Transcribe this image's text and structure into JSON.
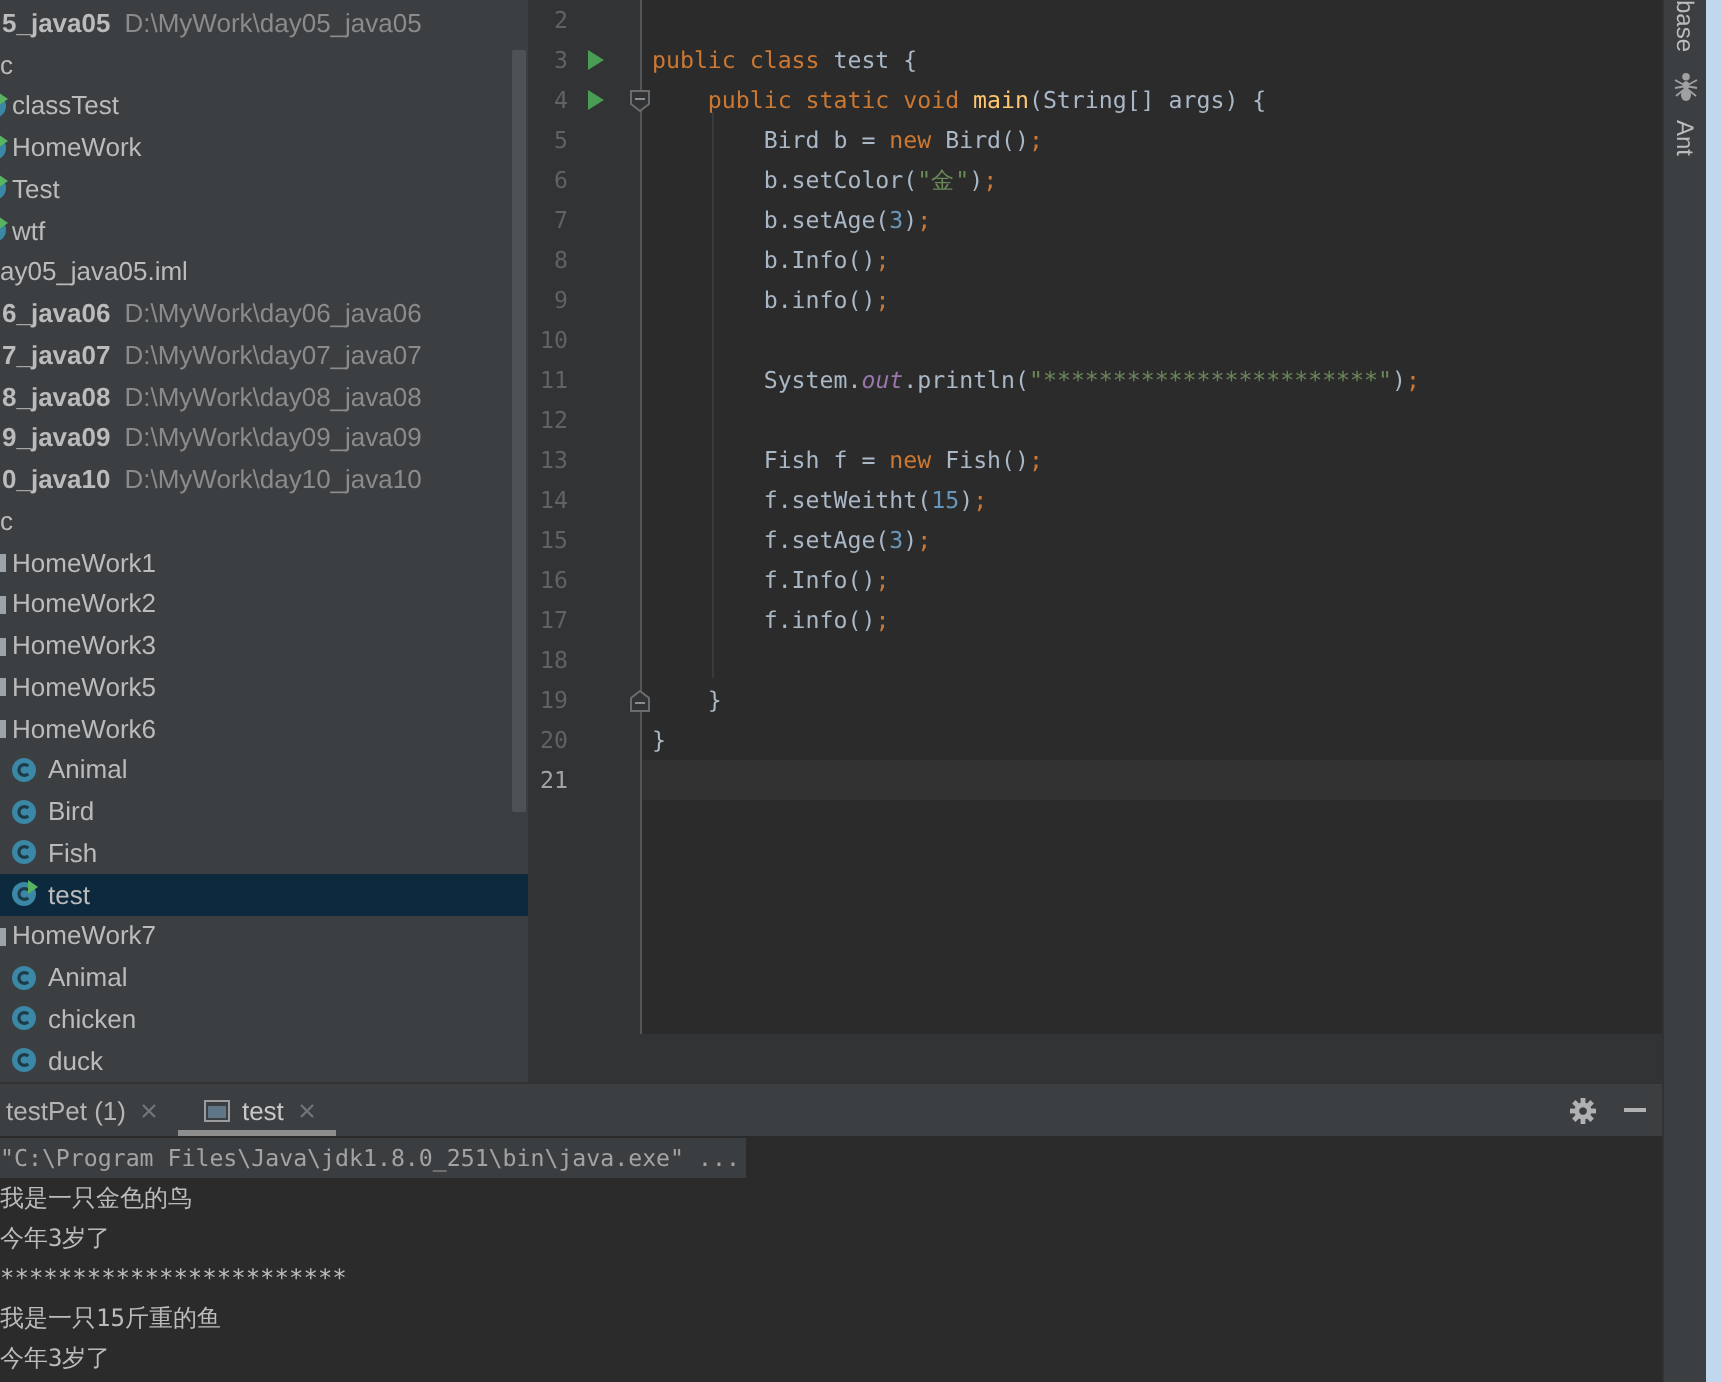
{
  "project_tree": {
    "items": [
      {
        "label": "5_java05",
        "kind": "module",
        "path": "D:\\MyWork\\day05_java05",
        "selected": false,
        "children": [
          {
            "label": "c",
            "selected": false,
            "children": [
              {
                "label": "classTest",
                "kind": "runnable_class",
                "selected": false
              },
              {
                "label": "HomeWork",
                "kind": "runnable_class",
                "selected": false
              },
              {
                "label": "Test",
                "kind": "runnable_class",
                "selected": false
              },
              {
                "label": "wtf",
                "kind": "runnable_class",
                "selected": false
              }
            ]
          },
          {
            "label": "ay05_java05.iml",
            "selected": false
          }
        ]
      },
      {
        "label": "6_java06",
        "kind": "module",
        "path": "D:\\MyWork\\day06_java06",
        "selected": false
      },
      {
        "label": "7_java07",
        "kind": "module",
        "path": "D:\\MyWork\\day07_java07",
        "selected": false
      },
      {
        "label": "8_java08",
        "kind": "module",
        "path": "D:\\MyWork\\day08_java08",
        "selected": false
      },
      {
        "label": "9_java09",
        "kind": "module",
        "path": "D:\\MyWork\\day09_java09",
        "selected": false
      },
      {
        "label": "0_java10",
        "kind": "module",
        "path": "D:\\MyWork\\day10_java10",
        "selected": false,
        "children": [
          {
            "label": "c",
            "selected": false,
            "children": [
              {
                "label": "HomeWork1",
                "kind": "package",
                "selected": false
              },
              {
                "label": "HomeWork2",
                "kind": "package",
                "selected": false
              },
              {
                "label": "HomeWork3",
                "kind": "package",
                "selected": false
              },
              {
                "label": "HomeWork5",
                "kind": "package",
                "selected": false
              },
              {
                "label": "HomeWork6",
                "kind": "package",
                "selected": false,
                "children": [
                  {
                    "label": "Animal",
                    "kind": "class",
                    "selected": false
                  },
                  {
                    "label": "Bird",
                    "kind": "class",
                    "selected": false
                  },
                  {
                    "label": "Fish",
                    "kind": "class",
                    "selected": false
                  },
                  {
                    "label": "test",
                    "kind": "runnable_class",
                    "selected": true
                  }
                ]
              },
              {
                "label": "HomeWork7",
                "kind": "package",
                "selected": false,
                "children": [
                  {
                    "label": "Animal",
                    "kind": "class",
                    "selected": false
                  },
                  {
                    "label": "chicken",
                    "kind": "class",
                    "selected": false
                  },
                  {
                    "label": "duck",
                    "kind": "class",
                    "selected": false
                  }
                ]
              }
            ]
          }
        ]
      }
    ]
  },
  "editor": {
    "lines": [
      {
        "number": "2",
        "runnable": false,
        "current": false,
        "fold_start": false,
        "fold_end": false
      },
      {
        "number": "3",
        "runnable": true,
        "current": false,
        "fold_start": false,
        "fold_end": false,
        "tokens": [
          {
            "text": "public class",
            "kind": "keyword"
          },
          {
            "text": " test {",
            "kind": "plain"
          }
        ]
      },
      {
        "number": "4",
        "runnable": true,
        "current": false,
        "fold_start": true,
        "fold_end": false,
        "tokens": [
          {
            "text": "    public static void ",
            "kind": "keyword"
          },
          {
            "text": "main",
            "kind": "method"
          },
          {
            "text": "(String[] args) {",
            "kind": "plain"
          }
        ]
      },
      {
        "number": "5",
        "runnable": false,
        "current": false,
        "fold_start": false,
        "fold_end": false,
        "tokens": [
          {
            "text": "        Bird b = ",
            "kind": "plain"
          },
          {
            "text": "new",
            "kind": "keyword"
          },
          {
            "text": " Bird()",
            "kind": "plain"
          },
          {
            "text": ";",
            "kind": "punct"
          }
        ]
      },
      {
        "number": "6",
        "runnable": false,
        "current": false,
        "fold_start": false,
        "fold_end": false,
        "tokens": [
          {
            "text": "        b.setColor(",
            "kind": "plain"
          },
          {
            "text": "\"金\"",
            "kind": "string"
          },
          {
            "text": ")",
            "kind": "plain"
          },
          {
            "text": ";",
            "kind": "punct"
          }
        ]
      },
      {
        "number": "7",
        "runnable": false,
        "current": false,
        "fold_start": false,
        "fold_end": false,
        "tokens": [
          {
            "text": "        b.setAge(",
            "kind": "plain"
          },
          {
            "text": "3",
            "kind": "number"
          },
          {
            "text": ")",
            "kind": "plain"
          },
          {
            "text": ";",
            "kind": "punct"
          }
        ]
      },
      {
        "number": "8",
        "runnable": false,
        "current": false,
        "fold_start": false,
        "fold_end": false,
        "tokens": [
          {
            "text": "        b.Info()",
            "kind": "plain"
          },
          {
            "text": ";",
            "kind": "punct"
          }
        ]
      },
      {
        "number": "9",
        "runnable": false,
        "current": false,
        "fold_start": false,
        "fold_end": false,
        "tokens": [
          {
            "text": "        b.info()",
            "kind": "plain"
          },
          {
            "text": ";",
            "kind": "punct"
          }
        ]
      },
      {
        "number": "10",
        "runnable": false,
        "current": false,
        "fold_start": false,
        "fold_end": false
      },
      {
        "number": "11",
        "runnable": false,
        "current": false,
        "fold_start": false,
        "fold_end": false,
        "tokens": [
          {
            "text": "        System.",
            "kind": "plain"
          },
          {
            "text": "out",
            "kind": "field"
          },
          {
            "text": ".println(",
            "kind": "plain"
          },
          {
            "text": "\"************************\"",
            "kind": "string"
          },
          {
            "text": ")",
            "kind": "plain"
          },
          {
            "text": ";",
            "kind": "punct"
          }
        ]
      },
      {
        "number": "12",
        "runnable": false,
        "current": false,
        "fold_start": false,
        "fold_end": false
      },
      {
        "number": "13",
        "runnable": false,
        "current": false,
        "fold_start": false,
        "fold_end": false,
        "tokens": [
          {
            "text": "        Fish f = ",
            "kind": "plain"
          },
          {
            "text": "new",
            "kind": "keyword"
          },
          {
            "text": " Fish()",
            "kind": "plain"
          },
          {
            "text": ";",
            "kind": "punct"
          }
        ]
      },
      {
        "number": "14",
        "runnable": false,
        "current": false,
        "fold_start": false,
        "fold_end": false,
        "tokens": [
          {
            "text": "        f.setWeitht(",
            "kind": "plain"
          },
          {
            "text": "15",
            "kind": "number"
          },
          {
            "text": ")",
            "kind": "plain"
          },
          {
            "text": ";",
            "kind": "punct"
          }
        ]
      },
      {
        "number": "15",
        "runnable": false,
        "current": false,
        "fold_start": false,
        "fold_end": false,
        "tokens": [
          {
            "text": "        f.setAge(",
            "kind": "plain"
          },
          {
            "text": "3",
            "kind": "number"
          },
          {
            "text": ")",
            "kind": "plain"
          },
          {
            "text": ";",
            "kind": "punct"
          }
        ]
      },
      {
        "number": "16",
        "runnable": false,
        "current": false,
        "fold_start": false,
        "fold_end": false,
        "tokens": [
          {
            "text": "        f.Info()",
            "kind": "plain"
          },
          {
            "text": ";",
            "kind": "punct"
          }
        ]
      },
      {
        "number": "17",
        "runnable": false,
        "current": false,
        "fold_start": false,
        "fold_end": false,
        "tokens": [
          {
            "text": "        f.info()",
            "kind": "plain"
          },
          {
            "text": ";",
            "kind": "punct"
          }
        ]
      },
      {
        "number": "18",
        "runnable": false,
        "current": false,
        "fold_start": false,
        "fold_end": false
      },
      {
        "number": "19",
        "runnable": false,
        "current": false,
        "fold_start": false,
        "fold_end": true,
        "tokens": [
          {
            "text": "    }",
            "kind": "plain"
          }
        ]
      },
      {
        "number": "20",
        "runnable": false,
        "current": false,
        "fold_start": false,
        "fold_end": false,
        "tokens": [
          {
            "text": "}",
            "kind": "plain"
          }
        ]
      },
      {
        "number": "21",
        "runnable": false,
        "current": true,
        "fold_start": false,
        "fold_end": false
      }
    ]
  },
  "run_panel": {
    "tabs": [
      {
        "label": "testPet (1)",
        "kind": "plain",
        "selected": false
      },
      {
        "label": "test",
        "kind": "console",
        "selected": true
      }
    ],
    "console": [
      {
        "text": "\"C:\\Program Files\\Java\\jdk1.8.0_251\\bin\\java.exe\" ...",
        "kind": "command"
      },
      {
        "text": "我是一只金色的鸟",
        "kind": "output"
      },
      {
        "text": "今年3岁了",
        "kind": "output"
      },
      {
        "text": "************************",
        "kind": "output"
      },
      {
        "text": "我是一只15斤重的鱼",
        "kind": "output"
      },
      {
        "text": "今年3岁了",
        "kind": "output"
      }
    ]
  },
  "right_toolbar": {
    "buttons": [
      {
        "label": "base",
        "kind": "plain"
      },
      {
        "label": "Ant",
        "kind": "ant"
      }
    ]
  }
}
